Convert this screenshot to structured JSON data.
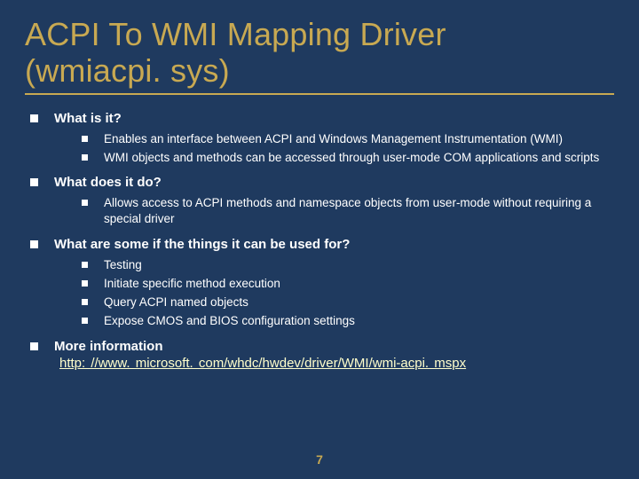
{
  "title_line1": "ACPI To WMI Mapping Driver",
  "title_line2": "(wmiacpi. sys)",
  "sections": {
    "s0": {
      "heading": "What is it?",
      "items": {
        "i0": "Enables an interface between ACPI and Windows Management Instrumentation (WMI)",
        "i1": "WMI objects and methods can be accessed through user-mode COM applications and scripts"
      }
    },
    "s1": {
      "heading": "What does it do?",
      "items": {
        "i0": "Allows access to ACPI methods and namespace objects from user-mode without requiring a special driver"
      }
    },
    "s2": {
      "heading": "What are some if the things it can be used for?",
      "items": {
        "i0": "Testing",
        "i1": "Initiate specific method execution",
        "i2": "Query ACPI named objects",
        "i3": "Expose CMOS and BIOS configuration settings"
      }
    },
    "s3": {
      "heading": "More information",
      "link": "http: //www. microsoft. com/whdc/hwdev/driver/WMI/wmi-acpi. mspx"
    }
  },
  "page_number": "7"
}
